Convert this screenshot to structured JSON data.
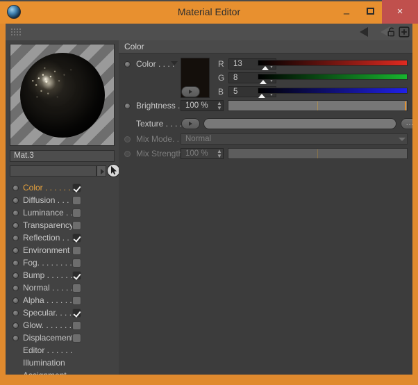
{
  "window": {
    "title": "Material Editor",
    "app_icon": "cinema4d-orb-icon",
    "minimize_label": "–",
    "maximize_label": "",
    "close_label": "×",
    "accent_color": "#e08a2e",
    "close_color": "#c0504d"
  },
  "toolbar": {
    "grip": "drag-grip",
    "collapse_arrow": "◀",
    "lock_icon": "lock-icon",
    "add_icon": "plus-box-icon"
  },
  "left_panel": {
    "preview_label": "material-preview-sphere",
    "material_name": "Mat.3",
    "selector_value": "",
    "channels": [
      {
        "label": "Color . . . . . .",
        "checked": true,
        "selected": true,
        "has_checkbox": true
      },
      {
        "label": "Diffusion . . .",
        "checked": false,
        "selected": false,
        "has_checkbox": true
      },
      {
        "label": "Luminance . .",
        "checked": false,
        "selected": false,
        "has_checkbox": true
      },
      {
        "label": "Transparency",
        "checked": false,
        "selected": false,
        "has_checkbox": true
      },
      {
        "label": "Reflection . .",
        "checked": true,
        "selected": false,
        "has_checkbox": true
      },
      {
        "label": "Environment",
        "checked": false,
        "selected": false,
        "has_checkbox": true
      },
      {
        "label": "Fog. . . . . . . .",
        "checked": false,
        "selected": false,
        "has_checkbox": true
      },
      {
        "label": "Bump . . . . . .",
        "checked": true,
        "selected": false,
        "has_checkbox": true
      },
      {
        "label": "Normal . . . . .",
        "checked": false,
        "selected": false,
        "has_checkbox": true
      },
      {
        "label": "Alpha . . . . . .",
        "checked": false,
        "selected": false,
        "has_checkbox": true
      },
      {
        "label": "Specular. . . .",
        "checked": true,
        "selected": false,
        "has_checkbox": true
      },
      {
        "label": "Glow. . . . . . .",
        "checked": false,
        "selected": false,
        "has_checkbox": true
      },
      {
        "label": "Displacement",
        "checked": false,
        "selected": false,
        "has_checkbox": true
      },
      {
        "label": "Editor . . . . . .",
        "checked": false,
        "selected": false,
        "has_checkbox": false
      },
      {
        "label": "Illumination",
        "checked": false,
        "selected": false,
        "has_checkbox": false
      },
      {
        "label": "Assignment",
        "checked": false,
        "selected": false,
        "has_checkbox": false
      }
    ]
  },
  "right_panel": {
    "section_title": "Color",
    "color_row": {
      "label": "Color  . . . .",
      "swatch_hex": "#140f0b",
      "channels": [
        {
          "name": "R",
          "value": "13",
          "gradient_to": "#e02a20",
          "knob_pct": 5.1
        },
        {
          "name": "G",
          "value": "8",
          "gradient_to": "#17b52e",
          "knob_pct": 3.1
        },
        {
          "name": "B",
          "value": "5",
          "gradient_to": "#2020e8",
          "knob_pct": 2.0
        }
      ]
    },
    "brightness": {
      "label": "Brightness . .",
      "value": "100 %",
      "fill_pct": 100
    },
    "texture": {
      "label": "Texture . . . . .",
      "value": "",
      "browse_label": "..."
    },
    "mix_mode": {
      "label": "Mix Mode. . .",
      "value": "Normal",
      "enabled": false
    },
    "mix_strength": {
      "label": "Mix Strength",
      "value": "100 %",
      "enabled": false
    }
  }
}
